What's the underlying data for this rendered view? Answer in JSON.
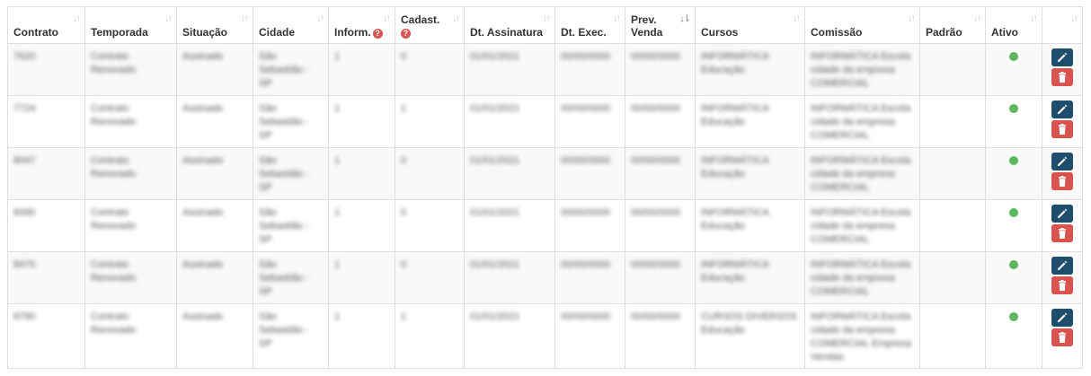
{
  "table": {
    "columns": [
      {
        "label": "Contrato",
        "help": false,
        "sort_active": false
      },
      {
        "label": "Temporada",
        "help": false,
        "sort_active": false
      },
      {
        "label": "Situação",
        "help": false,
        "sort_active": false
      },
      {
        "label": "Cidade",
        "help": false,
        "sort_active": false
      },
      {
        "label": "Inform.",
        "help": true,
        "sort_active": false
      },
      {
        "label": "Cadast.",
        "help": true,
        "sort_active": false
      },
      {
        "label": "Dt. Assinatura",
        "help": false,
        "sort_active": false
      },
      {
        "label": "Dt. Exec.",
        "help": false,
        "sort_active": false
      },
      {
        "label": "Prev. Venda",
        "help": false,
        "sort_active": true
      },
      {
        "label": "Cursos",
        "help": false,
        "sort_active": false
      },
      {
        "label": "Comissão",
        "help": false,
        "sort_active": false
      },
      {
        "label": "Padrão",
        "help": false,
        "sort_active": false
      },
      {
        "label": "Ativo",
        "help": false,
        "sort_active": false
      },
      {
        "label": "",
        "help": false,
        "sort_active": false
      }
    ],
    "sort_icon": "sort-arrows-icon",
    "help_icon": "question-circle-icon",
    "rows": [
      {
        "contrato": "7620",
        "temporada": "Contrato\nRenovado",
        "situacao": "Assinado",
        "cidade": "São\nSebastião - SP",
        "inform": "1",
        "cadast": "0",
        "dt_assinatura": "01/01/2021",
        "dt_exec": "00/00/0000",
        "prev_venda": "00/00/0000",
        "cursos": "INFORMÁTICA\nEducação",
        "comissao": "INFORMÁTICA Escola\ncidade da empresa\nCOMERCIAL",
        "padrao": "",
        "ativo": true
      },
      {
        "contrato": "7724",
        "temporada": "Contrato\nRenovado",
        "situacao": "Assinado",
        "cidade": "São\nSebastião - SP",
        "inform": "1",
        "cadast": "1",
        "dt_assinatura": "01/01/2021",
        "dt_exec": "00/00/0000",
        "prev_venda": "00/00/0000",
        "cursos": "INFORMÁTICA\nEducação",
        "comissao": "INFORMÁTICA Escola\ncidade da empresa\nCOMERCIAL",
        "padrao": "",
        "ativo": true
      },
      {
        "contrato": "8047",
        "temporada": "Contrato\nRenovado",
        "situacao": "Assinado",
        "cidade": "São\nSebastião - SP",
        "inform": "1",
        "cadast": "0",
        "dt_assinatura": "01/01/2021",
        "dt_exec": "00/00/0000",
        "prev_venda": "00/00/0000",
        "cursos": "INFORMÁTICA\nEducação",
        "comissao": "INFORMÁTICA Escola\ncidade da empresa\nCOMERCIAL",
        "padrao": "",
        "ativo": true
      },
      {
        "contrato": "8390",
        "temporada": "Contrato\nRenovado",
        "situacao": "Assinado",
        "cidade": "São\nSebastião - SP",
        "inform": "1",
        "cadast": "0",
        "dt_assinatura": "01/01/2021",
        "dt_exec": "00/00/0000",
        "prev_venda": "00/00/0000",
        "cursos": "INFORMÁTICA\nEducação",
        "comissao": "INFORMÁTICA Escola\ncidade da empresa\nCOMERCIAL",
        "padrao": "",
        "ativo": true
      },
      {
        "contrato": "8470",
        "temporada": "Contrato\nRenovado",
        "situacao": "Assinado",
        "cidade": "São\nSebastião - SP",
        "inform": "1",
        "cadast": "0",
        "dt_assinatura": "01/01/2021",
        "dt_exec": "00/00/0000",
        "prev_venda": "00/00/0000",
        "cursos": "INFORMÁTICA\nEducação",
        "comissao": "INFORMÁTICA Escola\ncidade da empresa\nCOMERCIAL",
        "padrao": "",
        "ativo": true
      },
      {
        "contrato": "8790",
        "temporada": "Contrato\nRenovado",
        "situacao": "Assinado",
        "cidade": "São\nSebastião - SP",
        "inform": "1",
        "cadast": "1",
        "dt_assinatura": "01/01/2021",
        "dt_exec": "00/00/0000",
        "prev_venda": "00/00/0000",
        "cursos": "CURSOS DIVERSOS\nEducação",
        "comissao": "INFORMÁTICA Escola\ncidade da empresa\nCOMERCIAL Empresa\nVendas",
        "padrao": "",
        "ativo": true
      }
    ],
    "actions": {
      "edit_icon": "pencil-icon",
      "delete_icon": "trash-icon",
      "edit_color": "#1f4e6d",
      "delete_color": "#d9534f"
    },
    "active_dot_color": "#5cb85c"
  }
}
